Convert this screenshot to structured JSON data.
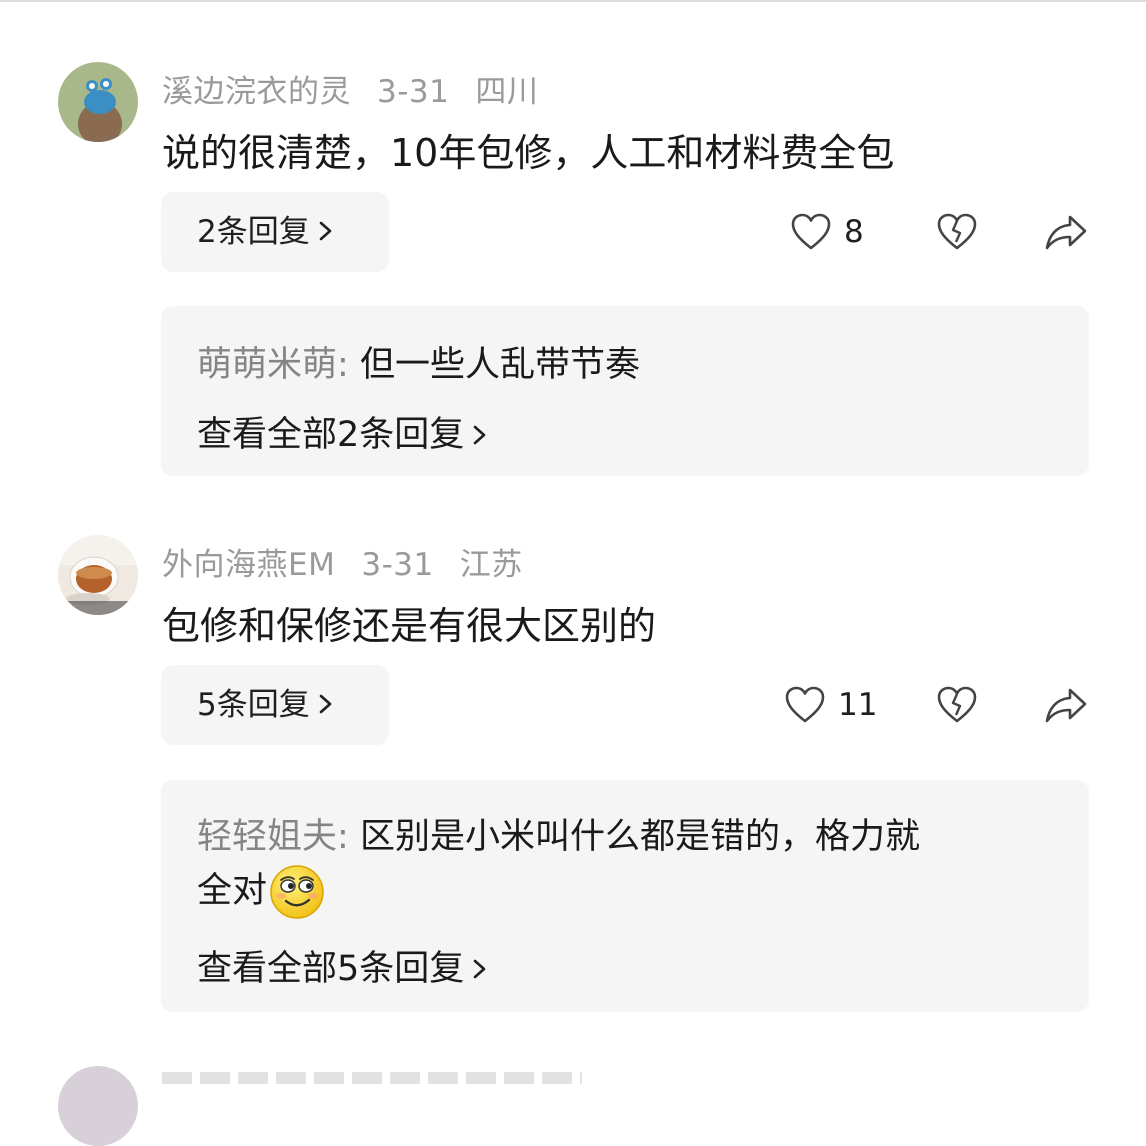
{
  "comments": [
    {
      "username": "溪边浣衣的灵",
      "date": "3-31",
      "location": "四川",
      "text": "说的很清楚，10年包修，人工和材料费全包",
      "reply_button": "2条回复",
      "likes": "8",
      "sub_reply": {
        "name": "萌萌米萌",
        "sep": ": ",
        "text": "但一些人乱带节奏",
        "text_line2": "",
        "view_all": "查看全部2条回复"
      }
    },
    {
      "username": "外向海燕EM",
      "date": "3-31",
      "location": "江苏",
      "text": "包修和保修还是有很大区别的",
      "reply_button": "5条回复",
      "likes": "11",
      "sub_reply": {
        "name": "轻轻姐夫",
        "sep": ": ",
        "text": "区别是小米叫什么都是错的，格力就",
        "text_line2": "全对",
        "view_all": "查看全部5条回复"
      }
    }
  ],
  "icons": {
    "chevron": "chevron-right-icon",
    "like": "heart-icon",
    "dislike": "broken-heart-icon",
    "share": "share-icon",
    "emoji": "smirk-emoji"
  },
  "colors": {
    "meta": "#9a9a9a",
    "bubble": "#f5f5f5",
    "sub_name": "#858585"
  }
}
